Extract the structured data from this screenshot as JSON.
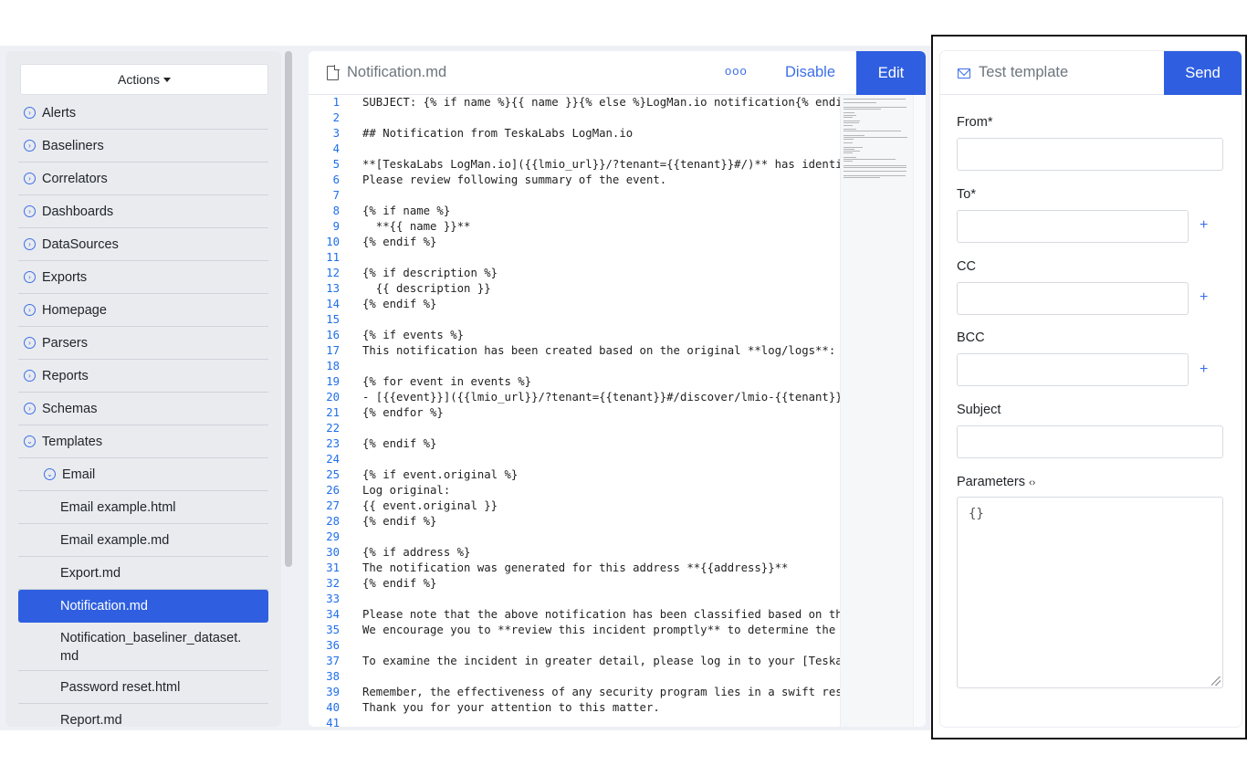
{
  "sidebar": {
    "actions_label": "Actions",
    "items": [
      {
        "label": "Alerts",
        "level": 0,
        "expanded": false
      },
      {
        "label": "Baseliners",
        "level": 0,
        "expanded": false
      },
      {
        "label": "Correlators",
        "level": 0,
        "expanded": false
      },
      {
        "label": "Dashboards",
        "level": 0,
        "expanded": false
      },
      {
        "label": "DataSources",
        "level": 0,
        "expanded": false
      },
      {
        "label": "Exports",
        "level": 0,
        "expanded": false
      },
      {
        "label": "Homepage",
        "level": 0,
        "expanded": false
      },
      {
        "label": "Parsers",
        "level": 0,
        "expanded": false
      },
      {
        "label": "Reports",
        "level": 0,
        "expanded": false
      },
      {
        "label": "Schemas",
        "level": 0,
        "expanded": false
      },
      {
        "label": "Templates",
        "level": 0,
        "expanded": true
      },
      {
        "label": "Email",
        "level": 1,
        "expanded": true
      },
      {
        "label": "Email example.html",
        "level": 2
      },
      {
        "label": "Email example.md",
        "level": 2
      },
      {
        "label": "Export.md",
        "level": 2
      },
      {
        "label": "Notification.md",
        "level": 2,
        "active": true
      },
      {
        "label": "Notification_baseliner_dataset.\nmd",
        "level": 2,
        "tall": true
      },
      {
        "label": "Password reset.html",
        "level": 2
      },
      {
        "label": "Report.md",
        "level": 2
      }
    ]
  },
  "editor": {
    "file_name": "Notification.md",
    "more_label": "ooo",
    "disable_label": "Disable",
    "edit_label": "Edit",
    "lines": [
      "SUBJECT: {% if name %}{{ name }}{% else %}LogMan.io notification{% endif %}",
      "",
      "## Notification from TeskaLabs LogMan.io",
      "",
      "**[TeskaLabs LogMan.io]({{lmio_url}}/?tenant={{tenant}}#/)** has identified a",
      "Please review following summary of the event.",
      "",
      "{% if name %}",
      "  **{{ name }}**",
      "{% endif %}",
      "",
      "{% if description %}",
      "  {{ description }}",
      "{% endif %}",
      "",
      "{% if events %}",
      "This notification has been created based on the original **log/logs**:",
      "",
      "{% for event in events %}",
      "- [{{event}}]({{lmio_url}}/?tenant={{tenant}}#/discover/lmio-{{tenant}}-events",
      "{% endfor %}",
      "",
      "{% endif %}",
      "",
      "{% if event.original %}",
      "Log original:",
      "{{ event.original }}",
      "{% endif %}",
      "",
      "{% if address %}",
      "The notification was generated for this address **{{address}}**",
      "{% endif %}",
      "",
      "Please note that the above notification has been classified based on the crit",
      "We encourage you to **review this incident promptly** to determine the next s",
      "",
      "To examine the incident in greater detail, please log in to your [TeskaLabs L",
      "",
      "Remember, the effectiveness of any security program lies in a swift response",
      "Thank you for your attention to this matter.",
      ""
    ]
  },
  "test_template": {
    "title": "Test template",
    "send_label": "Send",
    "from_label": "From*",
    "from_value": "",
    "to_label": "To*",
    "to_value": "",
    "cc_label": "CC",
    "cc_value": "",
    "bcc_label": "BCC",
    "bcc_value": "",
    "subject_label": "Subject",
    "subject_value": "",
    "parameters_label": "Parameters",
    "parameters_icon": "‹›",
    "parameters_value": "{}",
    "plus_label": "+"
  },
  "colors": {
    "primary": "#2f5fe0",
    "link": "#3d6fe8",
    "sidebar_bg": "#e9ebef",
    "app_bg": "#eef0f5"
  },
  "icons": {
    "tree_collapsed": "chevron-right-circle-icon",
    "tree_expanded": "chevron-down-circle-icon",
    "file": "file-icon",
    "mail": "envelope-icon",
    "caret": "caret-down-icon"
  }
}
